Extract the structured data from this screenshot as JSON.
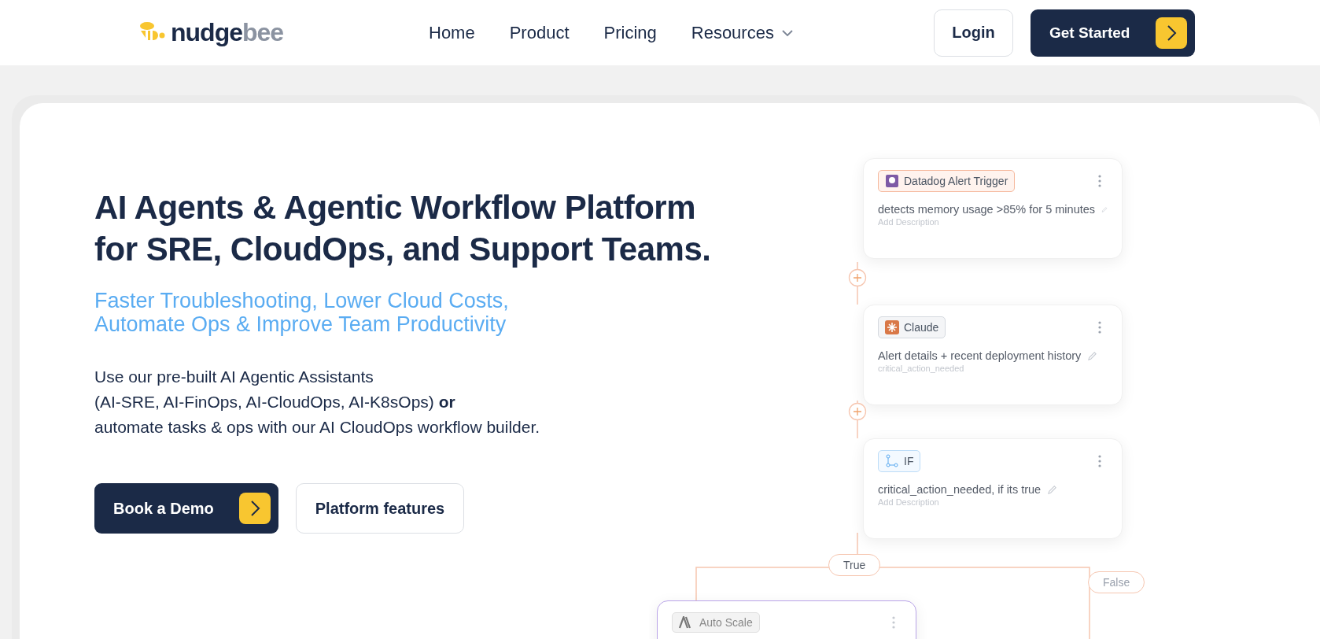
{
  "header": {
    "logo": {
      "parts": [
        "nudge",
        "bee"
      ]
    },
    "nav": [
      {
        "label": "Home",
        "has_menu": false
      },
      {
        "label": "Product",
        "has_menu": false
      },
      {
        "label": "Pricing",
        "has_menu": false
      },
      {
        "label": "Resources",
        "has_menu": true
      }
    ],
    "login": "Login",
    "cta": "Get Started"
  },
  "hero": {
    "title_lines": [
      "AI Agents & Agentic Workflow Platform",
      "for SRE, CloudOps, and Support Teams."
    ],
    "subtitle_lines": [
      "Faster Troubleshooting, Lower Cloud Costs,",
      "Automate Ops & Improve Team Productivity"
    ],
    "body_lines": [
      "Use our pre-built AI Agentic Assistants",
      "(AI-SRE, AI-FinOps, AI-CloudOps, AI-K8sOps) **or**",
      "automate tasks & ops with our AI CloudOps workflow builder."
    ],
    "primary_button": "Book a Demo",
    "secondary_button": "Platform features"
  },
  "workflow": {
    "nodes": [
      {
        "kind": "datadog",
        "tag": "Datadog Alert Trigger",
        "title": "detects memory usage >85% for 5 minutes",
        "description": "Add Description"
      },
      {
        "kind": "claude",
        "tag": "Claude",
        "title": "Alert details + recent deployment history",
        "description": "critical_action_needed"
      },
      {
        "kind": "condition",
        "tag": "IF",
        "title": "critical_action_needed, if its true",
        "description": "Add Description"
      }
    ],
    "branches": [
      "True",
      "False"
    ],
    "next_node": {
      "kind": "anthropic",
      "tag": "Auto Scale"
    }
  }
}
